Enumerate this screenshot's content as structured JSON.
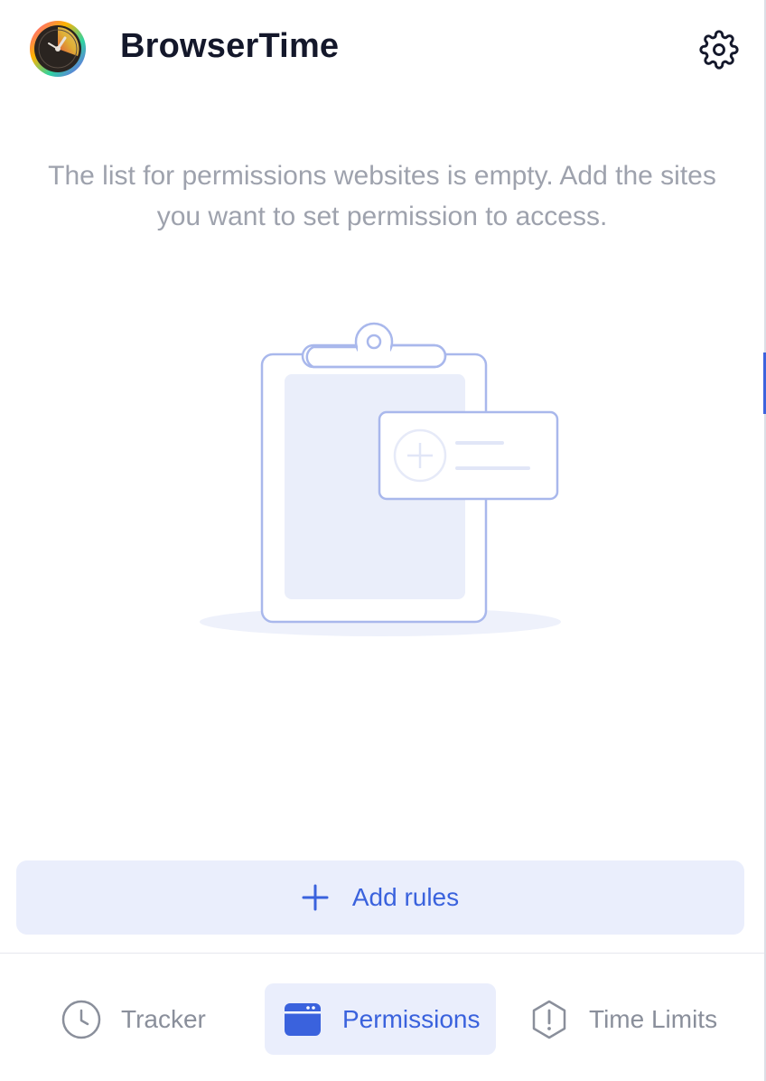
{
  "header": {
    "title": "BrowserTime",
    "logo_icon": "browsertime-logo-icon",
    "settings_icon": "gear-icon"
  },
  "empty_state": {
    "message": "The list for permissions websites is empty. Add the sites you want to set permission to access.",
    "illustration_icon": "clipboard-add-icon"
  },
  "actions": {
    "add_rules_label": "Add rules",
    "add_rules_icon": "plus-icon"
  },
  "nav": {
    "items": [
      {
        "label": "Tracker",
        "icon": "clock-icon",
        "active": false
      },
      {
        "label": "Permissions",
        "icon": "browser-window-icon",
        "active": true
      },
      {
        "label": "Time Limits",
        "icon": "alert-octagon-icon",
        "active": false
      }
    ]
  },
  "colors": {
    "accent": "#3a62dd",
    "accent_light": "#eaeefc",
    "muted_text": "#9ea2ad",
    "title_text": "#14182b"
  }
}
